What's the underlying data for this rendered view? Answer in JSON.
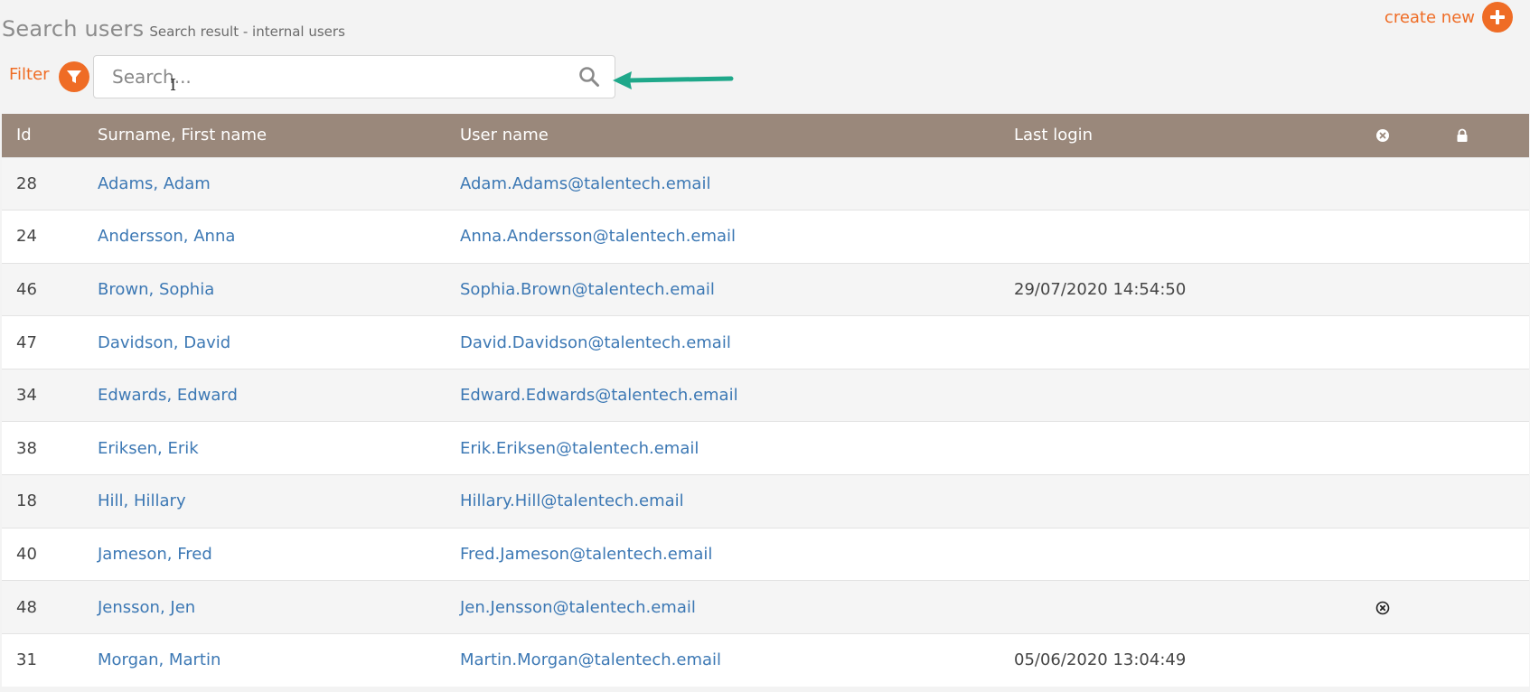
{
  "header": {
    "title": "Search users",
    "subtitle": "Search result - internal users",
    "create_new_label": "create new"
  },
  "filter": {
    "label": "Filter"
  },
  "search": {
    "placeholder": "Search..."
  },
  "icons": {
    "create_new": "plus-circle-icon",
    "filter": "funnel-icon",
    "search": "magnifier-icon",
    "annotation": "green-arrow-icon",
    "deactivated": "circle-x-icon",
    "locked": "lock-icon"
  },
  "colors": {
    "accent": "#ef6c25",
    "table_header": "#9a887b",
    "link": "#3c78b4",
    "arrow": "#1fa88a"
  },
  "table": {
    "columns": {
      "id": "Id",
      "name": "Surname, First name",
      "username": "User name",
      "last_login": "Last login"
    },
    "rows": [
      {
        "id": "28",
        "name": "Adams, Adam",
        "username": "Adam.Adams@talentech.email",
        "last_login": ""
      },
      {
        "id": "24",
        "name": "Andersson, Anna",
        "username": "Anna.Andersson@talentech.email",
        "last_login": ""
      },
      {
        "id": "46",
        "name": "Brown, Sophia",
        "username": "Sophia.Brown@talentech.email",
        "last_login": "29/07/2020 14:54:50"
      },
      {
        "id": "47",
        "name": "Davidson, David",
        "username": "David.Davidson@talentech.email",
        "last_login": ""
      },
      {
        "id": "34",
        "name": "Edwards, Edward",
        "username": "Edward.Edwards@talentech.email",
        "last_login": ""
      },
      {
        "id": "38",
        "name": "Eriksen, Erik",
        "username": "Erik.Eriksen@talentech.email",
        "last_login": ""
      },
      {
        "id": "18",
        "name": "Hill, Hillary",
        "username": "Hillary.Hill@talentech.email",
        "last_login": ""
      },
      {
        "id": "40",
        "name": "Jameson, Fred",
        "username": "Fred.Jameson@talentech.email",
        "last_login": ""
      },
      {
        "id": "48",
        "name": "Jensson, Jen",
        "username": "Jen.Jensson@talentech.email",
        "last_login": "",
        "deactivated": true
      },
      {
        "id": "31",
        "name": "Morgan, Martin",
        "username": "Martin.Morgan@talentech.email",
        "last_login": "05/06/2020 13:04:49"
      }
    ]
  }
}
